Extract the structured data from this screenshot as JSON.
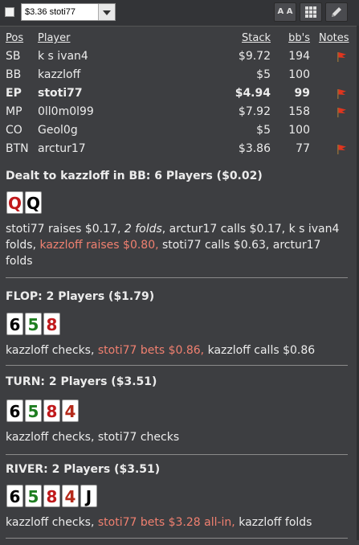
{
  "toolbar": {
    "select_value": "$3.36 stoti77",
    "font_button_label": "A A"
  },
  "players": {
    "headers": {
      "pos": "Pos",
      "player": "Player",
      "stack": "Stack",
      "bbs": "bb's",
      "notes": "Notes"
    },
    "rows": [
      {
        "pos": "SB",
        "player": "k s ivan4",
        "stack": "$9.72",
        "bbs": "194",
        "flag": true,
        "bold": false
      },
      {
        "pos": "BB",
        "player": "kazzloff",
        "stack": "$5",
        "bbs": "100",
        "flag": false,
        "bold": false
      },
      {
        "pos": "EP",
        "player": "stoti77",
        "stack": "$4.94",
        "bbs": "99",
        "flag": true,
        "bold": true
      },
      {
        "pos": "MP",
        "player": "0ll0m0l99",
        "stack": "$7.92",
        "bbs": "158",
        "flag": true,
        "bold": false
      },
      {
        "pos": "CO",
        "player": "Geol0g",
        "stack": "$5",
        "bbs": "100",
        "flag": false,
        "bold": false
      },
      {
        "pos": "BTN",
        "player": "arctur17",
        "stack": "$3.86",
        "bbs": "77",
        "flag": true,
        "bold": false
      }
    ]
  },
  "preflop": {
    "title": "Dealt to kazzloff in BB: 6 Players ($0.02)",
    "cards": [
      {
        "rank": "Q",
        "suit": "heart"
      },
      {
        "rank": "Q",
        "suit": "spade"
      }
    ],
    "action": [
      {
        "t": "stoti77 raises $0.17, ",
        "s": ""
      },
      {
        "t": "2 folds",
        "s": "it"
      },
      {
        "t": ", arctur17 calls $0.17, k s ivan4 folds, ",
        "s": ""
      },
      {
        "t": "kazzloff raises $0.80,",
        "s": "hl"
      },
      {
        "t": " stoti77 calls $0.63, arctur17 folds",
        "s": ""
      }
    ]
  },
  "flop": {
    "title": "FLOP: 2 Players ($1.79)",
    "cards": [
      {
        "rank": "6",
        "suit": "spade"
      },
      {
        "rank": "5",
        "suit": "club"
      },
      {
        "rank": "8",
        "suit": "heart"
      }
    ],
    "action": [
      {
        "t": "kazzloff checks, ",
        "s": ""
      },
      {
        "t": "stoti77 bets $0.86,",
        "s": "hl"
      },
      {
        "t": " kazzloff calls $0.86",
        "s": ""
      }
    ]
  },
  "turn": {
    "title": "TURN: 2 Players ($3.51)",
    "cards": [
      {
        "rank": "6",
        "suit": "spade"
      },
      {
        "rank": "5",
        "suit": "club"
      },
      {
        "rank": "8",
        "suit": "heart"
      },
      {
        "rank": "4",
        "suit": "diamond"
      }
    ],
    "action": [
      {
        "t": "kazzloff checks, stoti77 checks",
        "s": ""
      }
    ]
  },
  "river": {
    "title": "RIVER: 2 Players ($3.51)",
    "cards": [
      {
        "rank": "6",
        "suit": "spade"
      },
      {
        "rank": "5",
        "suit": "club"
      },
      {
        "rank": "8",
        "suit": "heart"
      },
      {
        "rank": "4",
        "suit": "diamond"
      },
      {
        "rank": "J",
        "suit": "spade"
      }
    ],
    "action": [
      {
        "t": "kazzloff checks, ",
        "s": ""
      },
      {
        "t": "stoti77 bets $3.28 all-in,",
        "s": "hl"
      },
      {
        "t": " kazzloff folds",
        "s": ""
      }
    ]
  },
  "colors": {
    "background": "#3d3e41",
    "highlight": "#f08070",
    "heart": "#c0191b",
    "club": "#1e7d20",
    "diamond": "#b52a1a",
    "spade": "#000000"
  }
}
